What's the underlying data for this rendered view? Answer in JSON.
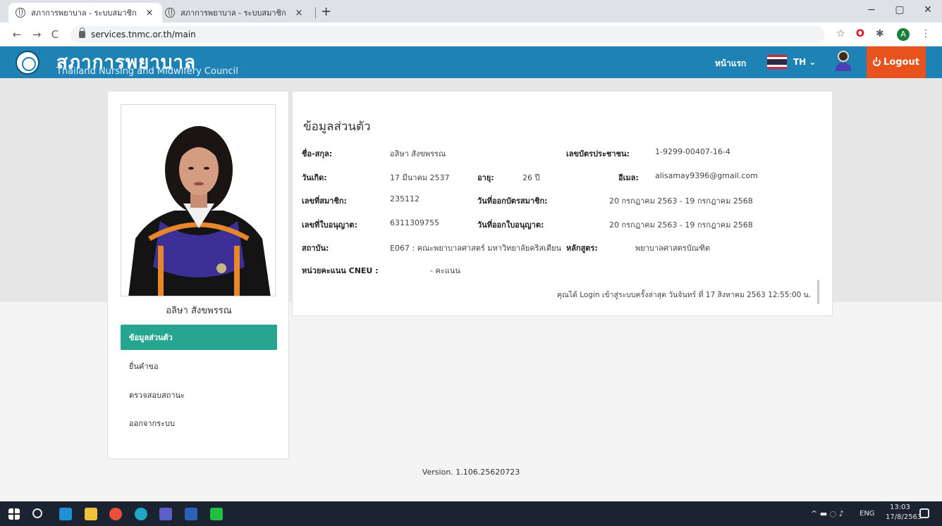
{
  "browser": {
    "tabs": [
      {
        "title": "สภาการพยาบาล - ระบบสมาชิก",
        "close": "×"
      },
      {
        "title": "สภาการพยาบาล - ระบบสมาชิก",
        "close": "×"
      }
    ],
    "new_tab": "+",
    "url": "services.tnmc.or.th/main",
    "window_controls": {
      "minimize": "−",
      "maximize": "▢",
      "close": "✕"
    },
    "nav": {
      "back": "←",
      "forward": "→",
      "reload": "C"
    },
    "profile_letter": "A"
  },
  "header": {
    "site_name": "สภาการพยาบาล",
    "site_subtitle": "Thailand Nursing and Midwifery Council",
    "home_link": "หน้าแรก",
    "language": "TH ⌄",
    "logout_label": "Logout",
    "accent_color": "#1e82b4",
    "logout_color": "#e8521d"
  },
  "sidebar": {
    "profile_name": "อลิษา สังขพรรณ",
    "menu": [
      {
        "label": "ข้อมูลส่วนตัว",
        "active": true
      },
      {
        "label": "ยื่นคำขอ",
        "active": false
      },
      {
        "label": "ตรวจสอบสถานะ",
        "active": false
      },
      {
        "label": "ออกจากระบบ",
        "active": false
      }
    ],
    "active_color": "#26a690"
  },
  "profile": {
    "title": "ข้อมูลส่วนตัว",
    "fullname_label": "ชื่อ-สกุล:",
    "fullname": "อลิษา สังขพรรณ",
    "id_label": "เลขบัตรประชาชน:",
    "id_number": "1-9299-00407-16-4",
    "dob_label": "วันเกิด:",
    "dob": "17 มีนาคม 2537",
    "age_label": "อายุ:",
    "age": "26 ปี",
    "email_label": "อีเมล:",
    "email": "alisamay9396@gmail.com",
    "member_no_label": "เลขที่สมาชิก:",
    "member_no": "235112",
    "member_card_label": "วันที่ออกบัตรสมาชิก:",
    "member_card_dates": "20 กรกฎาคม 2563 - 19 กรกฎาคม 2568",
    "license_no_label": "เลขที่ใบอนุญาต:",
    "license_no": "6311309755",
    "license_date_label": "วันที่ออกใบอนุญาต:",
    "license_dates": "20 กรกฎาคม 2563 - 19 กรกฎาคม 2568",
    "institute_label": "สถาบัน:",
    "institute": "E067 : คณะพยาบาลศาสตร์ มหาวิทยาลัยคริสเตียน",
    "program_label": "หลักสูตร:",
    "program": "พยาบาลศาสตรบัณฑิต",
    "cneu_label": "หน่วยคะแนน CNEU :",
    "cneu_value": "- คะแนน",
    "last_login": "คุณได้ Login เข้าสู่ระบบครั้งล่าสุด วันจันทร์ ที่ 17 สิงหาคม 2563 12:55:00 น."
  },
  "footer": {
    "version": "Version. 1.106.25620723"
  },
  "taskbar": {
    "language": "ENG",
    "time": "13:03",
    "date": "17/8/2563"
  }
}
